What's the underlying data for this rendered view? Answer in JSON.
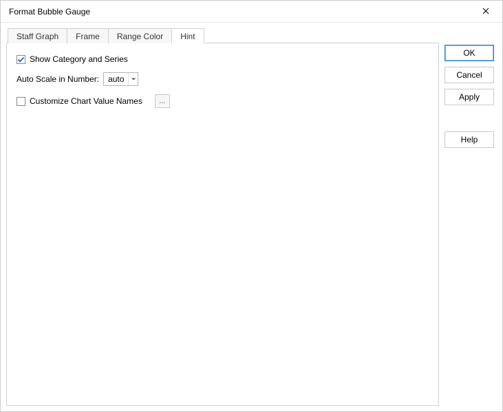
{
  "window": {
    "title": "Format Bubble Gauge"
  },
  "tabs": {
    "staff_graph": "Staff Graph",
    "frame": "Frame",
    "range_color": "Range Color",
    "hint": "Hint"
  },
  "hint_panel": {
    "show_category_label": "Show Category and Series",
    "show_category_checked": true,
    "auto_scale_label": "Auto Scale in Number:",
    "auto_scale_value": "auto",
    "customize_names_label": "Customize Chart Value Names",
    "customize_names_checked": false,
    "ellipsis_label": "..."
  },
  "buttons": {
    "ok": "OK",
    "cancel": "Cancel",
    "apply": "Apply",
    "help": "Help"
  }
}
